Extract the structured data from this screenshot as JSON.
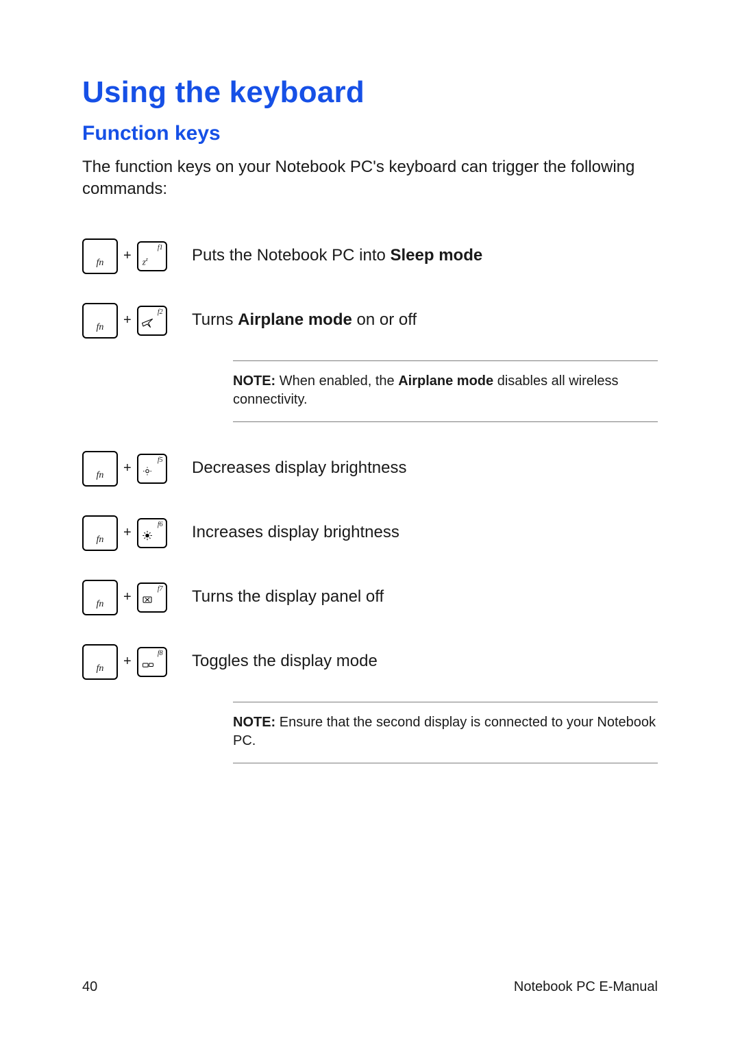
{
  "heading": "Using the keyboard",
  "subheading": "Function keys",
  "intro": "The function keys on your Notebook PC's keyboard can trigger the following commands:",
  "fn_label": "fn",
  "plus": "+",
  "rows": [
    {
      "f": "f1",
      "icon": "sleep",
      "desc_pre": "Puts the Notebook PC into ",
      "desc_bold": "Sleep mode",
      "desc_post": ""
    },
    {
      "f": "f2",
      "icon": "airplane",
      "desc_pre": "Turns ",
      "desc_bold": "Airplane mode",
      "desc_post": " on or off"
    },
    {
      "f": "f5",
      "icon": "sun-dim",
      "desc_pre": "Decreases display brightness",
      "desc_bold": "",
      "desc_post": ""
    },
    {
      "f": "f6",
      "icon": "sun-bright",
      "desc_pre": "Increases display brightness",
      "desc_bold": "",
      "desc_post": ""
    },
    {
      "f": "f7",
      "icon": "screen-off",
      "desc_pre": "Turns the display panel off",
      "desc_bold": "",
      "desc_post": ""
    },
    {
      "f": "f8",
      "icon": "dual",
      "desc_pre": "Toggles the display mode",
      "desc_bold": "",
      "desc_post": ""
    }
  ],
  "note1": {
    "label": "NOTE:",
    "pre": " When enabled, the ",
    "bold": "Airplane mode",
    "post": " disables all wireless connectivity."
  },
  "note2": {
    "label": "NOTE:",
    "text": " Ensure that the second display is connected to your Notebook PC."
  },
  "footer": {
    "page": "40",
    "title": "Notebook PC E-Manual"
  }
}
